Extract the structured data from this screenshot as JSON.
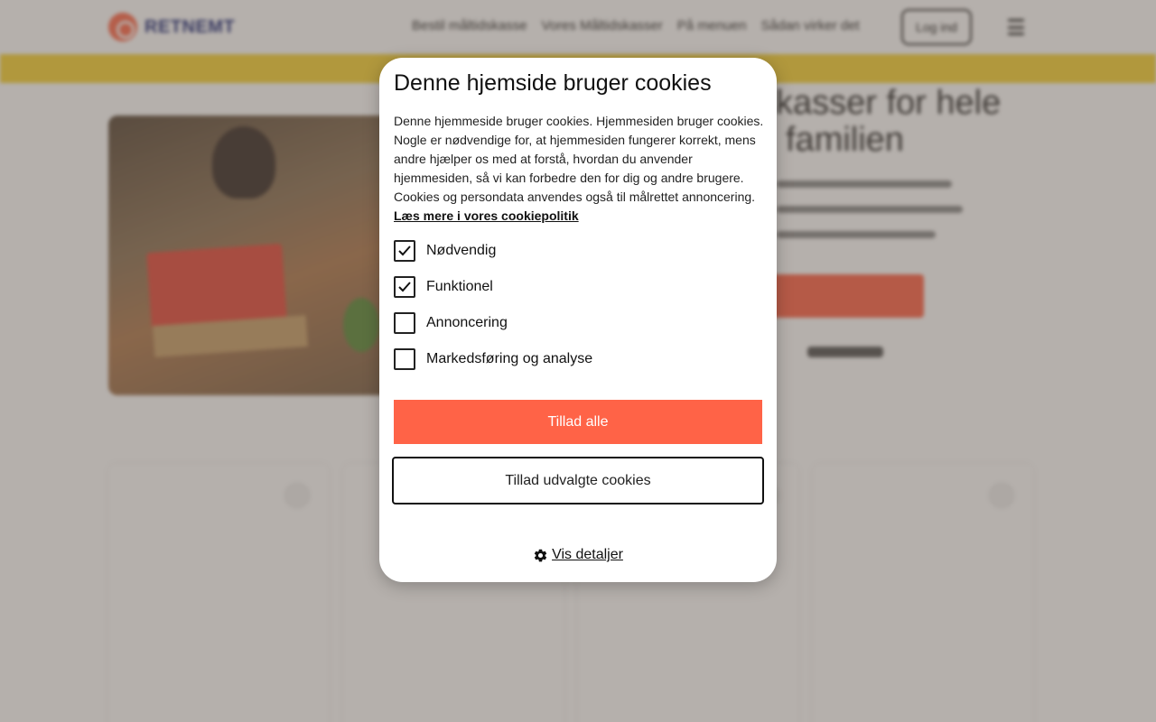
{
  "background": {
    "logo_text": "RETNEMT",
    "nav": [
      "Bestil måltidskasse",
      "Vores Måltidskasser",
      "På menuen",
      "Sådan virker det"
    ],
    "login_label": "Log ind",
    "hero_title_line1": "skasser for hele",
    "hero_title_line2": "familien"
  },
  "cookie_modal": {
    "title": "Denne hjemside bruger cookies",
    "description": "Denne hjemmeside bruger cookies. Hjemmesiden bruger cookies. Nogle er nødvendige for, at hjemmesiden fungerer korrekt, mens andre hjælper os med at forstå, hvordan du anvender hjemmesiden, så vi kan forbedre den for dig og andre brugere. Cookies og persondata anvendes også til målrettet annoncering.",
    "policy_link": "Læs mere i vores cookiepolitik",
    "options": [
      {
        "label": "Nødvendig",
        "checked": true
      },
      {
        "label": "Funktionel",
        "checked": true
      },
      {
        "label": "Annoncering",
        "checked": false
      },
      {
        "label": "Markedsføring og analyse",
        "checked": false
      }
    ],
    "allow_all_label": "Tillad alle",
    "allow_selected_label": "Tillad udvalgte cookies",
    "details_label": "Vis detaljer"
  },
  "colors": {
    "accent": "#ff6347",
    "banner": "#f7d335",
    "brand_navy": "#1e2a78"
  }
}
